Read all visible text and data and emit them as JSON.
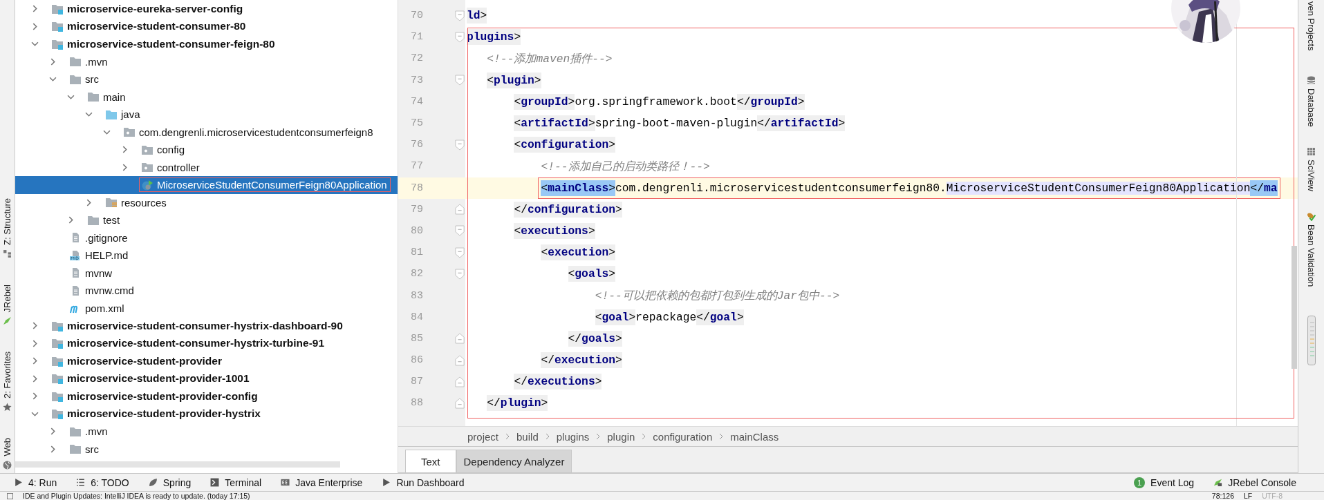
{
  "left_strip": [
    {
      "label": "Z: Structure",
      "kind": "structure"
    },
    {
      "label": "JRebel",
      "kind": "jrebel"
    },
    {
      "label": "2: Favorites",
      "kind": "favorites"
    },
    {
      "label": "Web",
      "kind": "web"
    }
  ],
  "project_tree": [
    {
      "label": "microservice-eureka-server-config",
      "kind": "module",
      "expanded": false,
      "selected": false,
      "outlined": false
    },
    {
      "label": "microservice-student-consumer-80",
      "kind": "module",
      "expanded": false,
      "selected": false,
      "outlined": false
    },
    {
      "label": "microservice-student-consumer-feign-80",
      "kind": "module",
      "expanded": true,
      "selected": false,
      "outlined": false,
      "children": [
        {
          "label": ".mvn",
          "kind": "folder",
          "expanded": false,
          "selected": false,
          "outlined": false
        },
        {
          "label": "src",
          "kind": "folder",
          "expanded": true,
          "selected": false,
          "outlined": false,
          "children": [
            {
              "label": "main",
              "kind": "folder",
              "expanded": true,
              "selected": false,
              "outlined": false,
              "children": [
                {
                  "label": "java",
                  "kind": "source-folder",
                  "expanded": true,
                  "selected": false,
                  "outlined": false,
                  "children": [
                    {
                      "label": "com.dengrenli.microservicestudentconsumerfeign8",
                      "kind": "package",
                      "expanded": true,
                      "selected": false,
                      "outlined": false,
                      "children": [
                        {
                          "label": "config",
                          "kind": "package",
                          "expanded": false,
                          "selected": false,
                          "outlined": false
                        },
                        {
                          "label": "controller",
                          "kind": "package",
                          "expanded": false,
                          "selected": false,
                          "outlined": false
                        },
                        {
                          "label": "MicroserviceStudentConsumerFeign80Application",
                          "kind": "spring-class",
                          "selected": true,
                          "outlined": true
                        }
                      ]
                    }
                  ]
                },
                {
                  "label": "resources",
                  "kind": "resource-folder",
                  "expanded": false,
                  "selected": false,
                  "outlined": false
                }
              ]
            },
            {
              "label": "test",
              "kind": "folder",
              "expanded": false,
              "selected": false,
              "outlined": false
            }
          ]
        },
        {
          "label": ".gitignore",
          "kind": "file",
          "selected": false,
          "outlined": false
        },
        {
          "label": "HELP.md",
          "kind": "markdown-file",
          "selected": false,
          "outlined": false
        },
        {
          "label": "mvnw",
          "kind": "file",
          "selected": false,
          "outlined": false
        },
        {
          "label": "mvnw.cmd",
          "kind": "file",
          "selected": false,
          "outlined": false
        },
        {
          "label": "pom.xml",
          "kind": "maven-file",
          "selected": false,
          "outlined": false
        }
      ]
    },
    {
      "label": "microservice-student-consumer-hystrix-dashboard-90",
      "kind": "module",
      "expanded": false,
      "selected": false,
      "outlined": false
    },
    {
      "label": "microservice-student-consumer-hystrix-turbine-91",
      "kind": "module",
      "expanded": false,
      "selected": false,
      "outlined": false
    },
    {
      "label": "microservice-student-provider",
      "kind": "module",
      "expanded": false,
      "selected": false,
      "outlined": false
    },
    {
      "label": "microservice-student-provider-1001",
      "kind": "module",
      "expanded": false,
      "selected": false,
      "outlined": false
    },
    {
      "label": "microservice-student-provider-config",
      "kind": "module",
      "expanded": false,
      "selected": false,
      "outlined": false
    },
    {
      "label": "microservice-student-provider-hystrix",
      "kind": "module",
      "expanded": true,
      "selected": false,
      "outlined": false,
      "children": [
        {
          "label": ".mvn",
          "kind": "folder",
          "expanded": false,
          "selected": false,
          "outlined": false
        },
        {
          "label": "src",
          "kind": "folder",
          "expanded": false,
          "selected": false,
          "outlined": false
        }
      ]
    }
  ],
  "editor": {
    "annotation_box": true,
    "avatar": {
      "kind": "picture"
    },
    "lines": [
      {
        "number": "70",
        "fold_start": true,
        "fold_end": false,
        "current": false,
        "outlined": false,
        "segments": [
          {
            "kind": "tag",
            "text": "ld>"
          }
        ]
      },
      {
        "number": "71",
        "fold_start": true,
        "fold_end": false,
        "current": false,
        "outlined": false,
        "segments": [
          {
            "kind": "tag",
            "text": "plugins>"
          }
        ]
      },
      {
        "number": "72",
        "fold_start": false,
        "fold_end": false,
        "current": false,
        "outlined": false,
        "segments": [
          {
            "kind": "comment",
            "text": "   <!--添加maven插件-->"
          }
        ]
      },
      {
        "number": "73",
        "fold_start": true,
        "fold_end": false,
        "current": false,
        "outlined": false,
        "segments": [
          {
            "kind": "tag",
            "text": "   <plugin>"
          }
        ]
      },
      {
        "number": "74",
        "fold_start": false,
        "fold_end": false,
        "current": false,
        "outlined": false,
        "segments": [
          {
            "kind": "tag",
            "text": "       <groupId>"
          },
          {
            "kind": "text",
            "text": "org.springframework.boot"
          },
          {
            "kind": "tag",
            "text": "</groupId>"
          }
        ]
      },
      {
        "number": "75",
        "fold_start": false,
        "fold_end": false,
        "current": false,
        "outlined": false,
        "segments": [
          {
            "kind": "tag",
            "text": "       <artifactId>"
          },
          {
            "kind": "text",
            "text": "spring-boot-maven-plugin"
          },
          {
            "kind": "tag",
            "text": "</artifactId>"
          }
        ]
      },
      {
        "number": "76",
        "fold_start": true,
        "fold_end": false,
        "current": false,
        "outlined": false,
        "segments": [
          {
            "kind": "tag",
            "text": "       <configuration>"
          }
        ]
      },
      {
        "number": "77",
        "fold_start": false,
        "fold_end": false,
        "current": false,
        "outlined": false,
        "segments": [
          {
            "kind": "comment",
            "text": "           <!--添加自己的启动类路径！-->"
          }
        ]
      },
      {
        "number": "78",
        "fold_start": false,
        "fold_end": false,
        "current": true,
        "outlined": true,
        "segments": [
          {
            "kind": "tag-selected",
            "text": "           <mainClass>"
          },
          {
            "kind": "text",
            "text": "com.dengrenli.microservicestudentconsumerfeign80."
          },
          {
            "kind": "text-marked",
            "text": "MicroserviceStudentConsumerFeign80Application"
          },
          {
            "kind": "tag-selected",
            "text": "</ma"
          }
        ]
      },
      {
        "number": "79",
        "fold_start": false,
        "fold_end": true,
        "current": false,
        "outlined": false,
        "segments": [
          {
            "kind": "tag",
            "text": "       </configuration>"
          }
        ]
      },
      {
        "number": "80",
        "fold_start": true,
        "fold_end": false,
        "current": false,
        "outlined": false,
        "segments": [
          {
            "kind": "tag",
            "text": "       <executions>"
          }
        ]
      },
      {
        "number": "81",
        "fold_start": true,
        "fold_end": false,
        "current": false,
        "outlined": false,
        "segments": [
          {
            "kind": "tag",
            "text": "           <execution>"
          }
        ]
      },
      {
        "number": "82",
        "fold_start": true,
        "fold_end": false,
        "current": false,
        "outlined": false,
        "segments": [
          {
            "kind": "tag",
            "text": "               <goals>"
          }
        ]
      },
      {
        "number": "83",
        "fold_start": false,
        "fold_end": false,
        "current": false,
        "outlined": false,
        "segments": [
          {
            "kind": "comment",
            "text": "                   <!--可以把依赖的包都打包到生成的Jar包中-->"
          }
        ]
      },
      {
        "number": "84",
        "fold_start": false,
        "fold_end": false,
        "current": false,
        "outlined": false,
        "segments": [
          {
            "kind": "tag",
            "text": "                   <goal>"
          },
          {
            "kind": "text",
            "text": "repackage"
          },
          {
            "kind": "tag",
            "text": "</goal>"
          }
        ]
      },
      {
        "number": "85",
        "fold_start": false,
        "fold_end": true,
        "current": false,
        "outlined": false,
        "segments": [
          {
            "kind": "tag",
            "text": "               </goals>"
          }
        ]
      },
      {
        "number": "86",
        "fold_start": false,
        "fold_end": true,
        "current": false,
        "outlined": false,
        "segments": [
          {
            "kind": "tag",
            "text": "           </execution>"
          }
        ]
      },
      {
        "number": "87",
        "fold_start": false,
        "fold_end": true,
        "current": false,
        "outlined": false,
        "segments": [
          {
            "kind": "tag",
            "text": "       </executions>"
          }
        ]
      },
      {
        "number": "88",
        "fold_start": false,
        "fold_end": true,
        "current": false,
        "outlined": false,
        "segments": [
          {
            "kind": "tag",
            "text": "   </plugin>"
          }
        ]
      }
    ],
    "breadcrumbs": [
      "project",
      "build",
      "plugins",
      "plugin",
      "configuration",
      "mainClass"
    ],
    "tabs": [
      {
        "label": "Text",
        "selected": true
      },
      {
        "label": "Dependency Analyzer",
        "selected": false
      }
    ]
  },
  "right_strip": [
    {
      "label": "ven Projects",
      "kind": "none"
    },
    {
      "label": "Database",
      "kind": "database"
    },
    {
      "label": "SciView",
      "kind": "sciview"
    },
    {
      "label": "Bean Validation",
      "kind": "bean"
    }
  ],
  "tool_windows": [
    {
      "label": "4: Run",
      "kind": "run"
    },
    {
      "label": "6: TODO",
      "kind": "todo"
    },
    {
      "label": "Spring",
      "kind": "spring"
    },
    {
      "label": "Terminal",
      "kind": "terminal"
    },
    {
      "label": "Java Enterprise",
      "kind": "enterprise"
    },
    {
      "label": "Run Dashboard",
      "kind": "run"
    }
  ],
  "tool_windows_right": [
    {
      "label": "Event Log",
      "kind": "event",
      "badge": "1"
    },
    {
      "label": "JRebel Console",
      "kind": "jrebel"
    }
  ],
  "status_bar": {
    "message": "IDE and Plugin Updates: IntelliJ IDEA is ready to update. (today 17:15)",
    "position": "78:126",
    "line_separator": "LF",
    "encoding": "UTF-8",
    "encoding_disabled": true
  }
}
